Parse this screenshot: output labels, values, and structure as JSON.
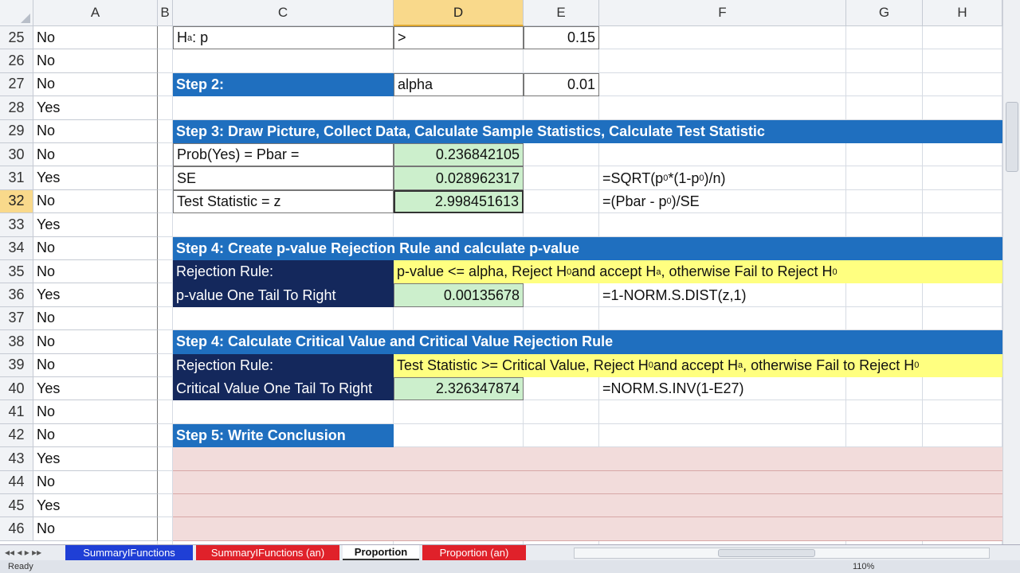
{
  "columns": [
    "A",
    "B",
    "C",
    "D",
    "E",
    "F",
    "G",
    "H"
  ],
  "rows": [
    {
      "num": "25",
      "a": "No"
    },
    {
      "num": "26",
      "a": "No"
    },
    {
      "num": "27",
      "a": "No"
    },
    {
      "num": "28",
      "a": "Yes"
    },
    {
      "num": "29",
      "a": "No"
    },
    {
      "num": "30",
      "a": "No"
    },
    {
      "num": "31",
      "a": "Yes"
    },
    {
      "num": "32",
      "a": "No"
    },
    {
      "num": "33",
      "a": "Yes"
    },
    {
      "num": "34",
      "a": "No"
    },
    {
      "num": "35",
      "a": "No"
    },
    {
      "num": "36",
      "a": "Yes"
    },
    {
      "num": "37",
      "a": "No"
    },
    {
      "num": "38",
      "a": "No"
    },
    {
      "num": "39",
      "a": "No"
    },
    {
      "num": "40",
      "a": "Yes"
    },
    {
      "num": "41",
      "a": "No"
    },
    {
      "num": "42",
      "a": "No"
    },
    {
      "num": "43",
      "a": "Yes"
    },
    {
      "num": "44",
      "a": "No"
    },
    {
      "num": "45",
      "a": "Yes"
    },
    {
      "num": "46",
      "a": "No"
    }
  ],
  "selected_row": "32",
  "selected_col": "D",
  "sheet": {
    "ha_label": "H",
    "ha_sub": "a",
    "ha_rest": " : p",
    "ha_op": ">",
    "ha_value": "0.15",
    "step2": "Step 2:",
    "alpha_label": "alpha",
    "alpha_value": "0.01",
    "step3": "Step 3: Draw Picture, Collect Data, Calculate Sample Statistics, Calculate Test Statistic",
    "pbar_label": "Prob(Yes) = Pbar =",
    "pbar_value": "0.236842105",
    "se_label": "SE",
    "se_value": "0.028962317",
    "se_formula": "=SQRT(p₀*(1-p₀)/n)",
    "z_label": "Test Statistic = z",
    "z_value": "2.998451613",
    "z_formula": "=(Pbar - p₀)/SE",
    "step4a": "Step 4: Create p-value Rejection Rule and calculate p-value",
    "rr_label": "Rejection Rule:",
    "rr_pvalue": "p-value <= alpha, Reject H₀ and accept Hₐ , otherwise Fail to Reject H₀",
    "pv_label": "p-value One Tail To Right",
    "pv_value": "0.00135678",
    "pv_formula": "=1-NORM.S.DIST(z,1)",
    "step4b": "Step 4: Calculate Critical Value and Critical Value Rejection Rule",
    "rr2_label": "Rejection Rule:",
    "rr_cv": "Test Statistic >= Critical Value, Reject H₀ and accept Hₐ , otherwise Fail to Reject H₀",
    "cv_label": "Critical Value One Tail To Right",
    "cv_value": "2.326347874",
    "cv_formula": "=NORM.S.INV(1-E27)",
    "step5": "Step 5: Write Conclusion"
  },
  "tabs": [
    {
      "label": "SummaryIFunctions",
      "color": "#1f3fd6",
      "text": "#ffffff"
    },
    {
      "label": "SummaryIFunctions (an)",
      "color": "#e0212a",
      "text": "#ffffff"
    },
    {
      "label": "Proportion",
      "color": "#ffffff",
      "text": "#111111"
    },
    {
      "label": "Proportion (an)",
      "color": "#e0212a",
      "text": "#ffffff"
    }
  ],
  "status": {
    "ready": "Ready",
    "zoom": "110%"
  }
}
